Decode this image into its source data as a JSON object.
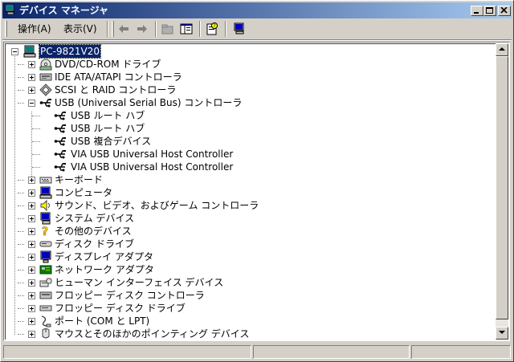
{
  "window": {
    "title": "デバイス マネージャ"
  },
  "menu": {
    "action": "操作(A)",
    "view": "表示(V)"
  },
  "toolbar": {
    "items": [
      {
        "name": "back-arrow-icon"
      },
      {
        "name": "forward-arrow-icon"
      },
      {
        "name": "folder-up-icon"
      },
      {
        "name": "show-hide-tree-icon"
      },
      {
        "name": "properties-help-icon"
      },
      {
        "name": "update-driver-icon"
      }
    ]
  },
  "tree": {
    "root": "PC-9821V20",
    "categories": [
      {
        "label": "DVD/CD-ROM ドライブ",
        "icon": "cdrom-icon",
        "expanded": false
      },
      {
        "label": "IDE ATA/ATAPI コントローラ",
        "icon": "ide-controller-icon",
        "expanded": false
      },
      {
        "label": "SCSI と RAID コントローラ",
        "icon": "scsi-controller-icon",
        "expanded": false
      },
      {
        "label": "USB (Universal Serial Bus) コントローラ",
        "icon": "usb-icon",
        "expanded": true,
        "children": [
          "USB ルート ハブ",
          "USB ルート ハブ",
          "USB 複合デバイス",
          "VIA USB Universal Host Controller",
          "VIA USB Universal Host Controller"
        ]
      },
      {
        "label": "キーボード",
        "icon": "keyboard-icon",
        "expanded": false
      },
      {
        "label": "コンピュータ",
        "icon": "computer-icon",
        "expanded": false
      },
      {
        "label": "サウンド、ビデオ、およびゲーム コントローラ",
        "icon": "sound-icon",
        "expanded": false
      },
      {
        "label": "システム デバイス",
        "icon": "system-device-icon",
        "expanded": false
      },
      {
        "label": "その他のデバイス",
        "icon": "unknown-device-icon",
        "expanded": false
      },
      {
        "label": "ディスク ドライブ",
        "icon": "disk-drive-icon",
        "expanded": false
      },
      {
        "label": "ディスプレイ アダプタ",
        "icon": "display-adapter-icon",
        "expanded": false
      },
      {
        "label": "ネットワーク アダプタ",
        "icon": "network-adapter-icon",
        "expanded": false
      },
      {
        "label": "ヒューマン インターフェイス デバイス",
        "icon": "hid-icon",
        "expanded": false
      },
      {
        "label": "フロッピー ディスク コントローラ",
        "icon": "floppy-controller-icon",
        "expanded": false
      },
      {
        "label": "フロッピー ディスク ドライブ",
        "icon": "floppy-drive-icon",
        "expanded": false
      },
      {
        "label": "ポート (COM と LPT)",
        "icon": "port-icon",
        "expanded": false
      },
      {
        "label": "マウスとそのほかのポインティング デバイス",
        "icon": "mouse-icon",
        "expanded": false
      }
    ]
  },
  "colors": {
    "title_start": "#0a246a",
    "title_end": "#a6caf0",
    "face": "#d4d0c8",
    "selection": "#0a246a"
  }
}
